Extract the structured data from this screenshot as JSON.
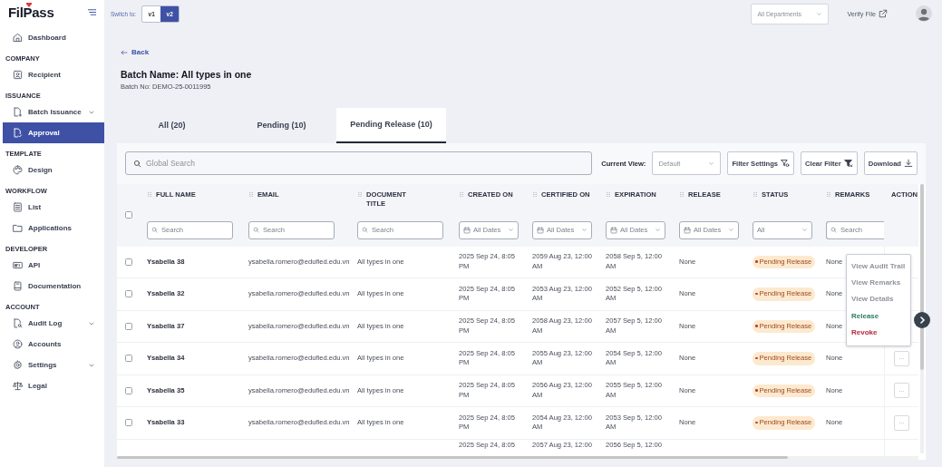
{
  "sidebar": {
    "logo": "FilPass",
    "sections": [
      {
        "items": [
          {
            "label": "Dashboard",
            "selected": false,
            "expandable": false
          }
        ]
      },
      {
        "heading": "COMPANY",
        "items": [
          {
            "label": "Recipient",
            "selected": false,
            "expandable": false
          }
        ]
      },
      {
        "heading": "ISSUANCE",
        "items": [
          {
            "label": "Batch Issuance",
            "selected": false,
            "expandable": true
          },
          {
            "label": "Approval",
            "selected": true,
            "expandable": false
          }
        ]
      },
      {
        "heading": "TEMPLATE",
        "items": [
          {
            "label": "Design",
            "selected": false,
            "expandable": false
          }
        ]
      },
      {
        "heading": "WORKFLOW",
        "items": [
          {
            "label": "List",
            "selected": false,
            "expandable": false
          },
          {
            "label": "Applications",
            "selected": false,
            "expandable": false
          }
        ]
      },
      {
        "heading": "DEVELOPER",
        "items": [
          {
            "label": "API",
            "selected": false,
            "expandable": false
          },
          {
            "label": "Documentation",
            "selected": false,
            "expandable": false
          }
        ]
      },
      {
        "heading": "ACCOUNT",
        "items": [
          {
            "label": "Audit Log",
            "selected": false,
            "expandable": true
          },
          {
            "label": "Accounts",
            "selected": false,
            "expandable": false
          },
          {
            "label": "Settings",
            "selected": false,
            "expandable": true
          },
          {
            "label": "Legal",
            "selected": false,
            "expandable": false
          }
        ]
      }
    ]
  },
  "topbar": {
    "switch_label": "Switch to:",
    "versions": [
      {
        "label": "v1",
        "selected": false
      },
      {
        "label": "v2",
        "selected": true
      }
    ],
    "department": "All Departments",
    "verify": "Verify File"
  },
  "back": "Back",
  "batch_name": "Batch Name: All types in one",
  "batch_no": "Batch No: DEMO-25-0011995",
  "tabs": [
    {
      "label": "All (20)",
      "selected": false
    },
    {
      "label": "Pending (10)",
      "selected": false
    },
    {
      "label": "Pending Release (10)",
      "selected": true
    }
  ],
  "toolbar": {
    "search_placeholder": "Global Search",
    "view_label": "Current View:",
    "view": "Default",
    "buttons": [
      "Filter Settings",
      "Clear Filter",
      "Download"
    ]
  },
  "table": {
    "all_checked": false,
    "columns": [
      {
        "label": "FULL NAME",
        "kind": "bold",
        "filter": {
          "kind": "search",
          "placeholder": "Search"
        }
      },
      {
        "label": "EMAIL",
        "kind": "text",
        "filter": {
          "kind": "search",
          "placeholder": "Search"
        }
      },
      {
        "label": "DOCUMENT TITLE",
        "kind": "text",
        "filter": {
          "kind": "search",
          "placeholder": "Search"
        }
      },
      {
        "label": "CREATED ON",
        "kind": "text",
        "filter": {
          "kind": "date",
          "value": "All Dates"
        }
      },
      {
        "label": "CERTIFIED ON",
        "kind": "text",
        "filter": {
          "kind": "date",
          "value": "All Dates"
        }
      },
      {
        "label": "EXPIRATION",
        "kind": "text",
        "filter": {
          "kind": "date",
          "value": "All Dates"
        }
      },
      {
        "label": "RELEASE",
        "kind": "text",
        "filter": {
          "kind": "date",
          "value": "All Dates"
        }
      },
      {
        "label": "STATUS",
        "kind": "badge",
        "filter": {
          "kind": "select",
          "value": "All"
        }
      },
      {
        "label": "REMARKS",
        "kind": "text",
        "filter": {
          "kind": "search",
          "placeholder": "Search"
        }
      },
      {
        "label": "ACTION",
        "kind": "action"
      }
    ],
    "rows": [
      {
        "checked": false,
        "cells": [
          "Ysabella 38",
          "ysabella.romero@edufied.edu.vn",
          "All types in one",
          "2025 Sep 24, 8:05 PM",
          "2059 Aug 23, 12:00 AM",
          "2058 Sep 5, 12:00 AM",
          "None",
          "Pending Release",
          "None"
        ]
      },
      {
        "checked": false,
        "cells": [
          "Ysabella 32",
          "ysabella.romero@edufied.edu.vn",
          "All types in one",
          "2025 Sep 24, 8:05 PM",
          "2053 Aug 23, 12:00 AM",
          "2052 Sep 5, 12:00 AM",
          "None",
          "Pending Release",
          "None"
        ]
      },
      {
        "checked": false,
        "cells": [
          "Ysabella 37",
          "ysabella.romero@edufied.edu.vn",
          "All types in one",
          "2025 Sep 24, 8:05 PM",
          "2058 Aug 23, 12:00 AM",
          "2057 Sep 5, 12:00 AM",
          "None",
          "Pending Release",
          "None"
        ]
      },
      {
        "checked": false,
        "cells": [
          "Ysabella 34",
          "ysabella.romero@edufied.edu.vn",
          "All types in one",
          "2025 Sep 24, 8:05 PM",
          "2055 Aug 23, 12:00 AM",
          "2054 Sep 5, 12:00 AM",
          "None",
          "Pending Release",
          "None"
        ],
        "action": "···"
      },
      {
        "checked": false,
        "cells": [
          "Ysabella 35",
          "ysabella.romero@edufied.edu.vn",
          "All types in one",
          "2025 Sep 24, 8:05 PM",
          "2056 Aug 23, 12:00 AM",
          "2055 Sep 5, 12:00 AM",
          "None",
          "Pending Release",
          "None"
        ],
        "action": "···"
      },
      {
        "checked": false,
        "cells": [
          "Ysabella 33",
          "ysabella.romero@edufied.edu.vn",
          "All types in one",
          "2025 Sep 24, 8:05 PM",
          "2054 Aug 23, 12:00 AM",
          "2053 Sep 5, 12:00 AM",
          "None",
          "Pending Release",
          "None"
        ],
        "action": "···"
      },
      {
        "partial": true,
        "cells": [
          null,
          null,
          null,
          "2025 Sep 24, 8:05",
          "2057 Aug 23, 12:00",
          "2056 Sep 5, 12:00",
          null,
          null,
          null
        ]
      }
    ]
  },
  "menu": {
    "items": [
      {
        "label": "View Audit Trail",
        "color": "#8f939b"
      },
      {
        "label": "View Remarks",
        "color": "#8f939b"
      },
      {
        "label": "View Details",
        "color": "#8f939b"
      },
      {
        "label": "Release",
        "color": "#2e7d62"
      },
      {
        "label": "Revoke",
        "color": "#b3263e"
      }
    ]
  }
}
